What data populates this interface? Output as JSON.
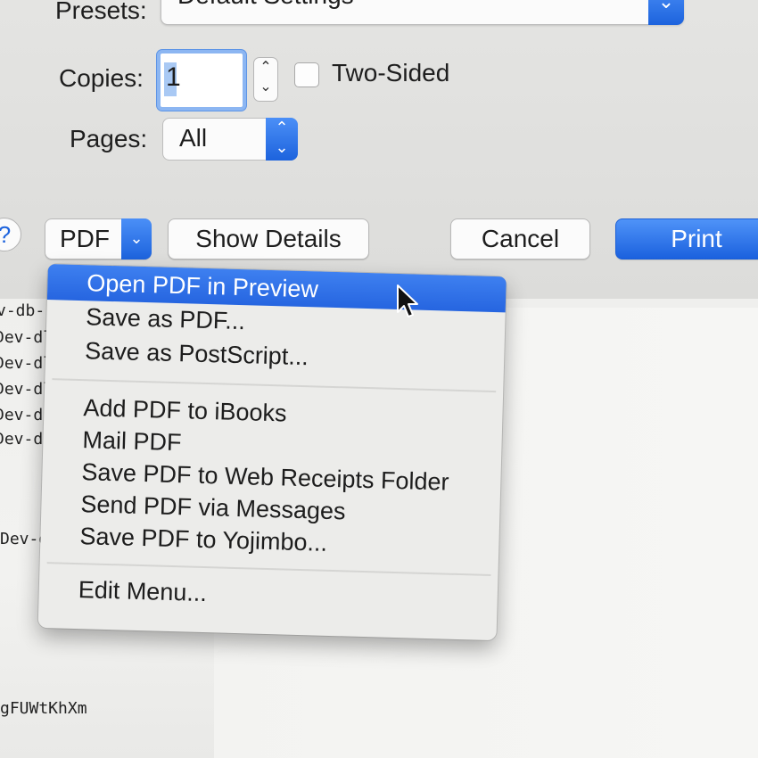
{
  "print_dialog": {
    "presets_label": "Presets:",
    "presets_value": "Default Settings",
    "copies_label": "Copies:",
    "copies_value": "1",
    "two_sided_label": "Two-Sided",
    "pages_label": "Pages:",
    "pages_value": "All",
    "help_label": "?",
    "pdf_button_label": "PDF",
    "show_details_label": "Show Details",
    "cancel_label": "Cancel",
    "print_label": "Print"
  },
  "pdf_menu": {
    "items": [
      {
        "label": "Open PDF in Preview"
      },
      {
        "label": "Save as PDF..."
      },
      {
        "label": "Save as PostScript..."
      },
      {
        "label": "Add PDF to iBooks"
      },
      {
        "label": "Mail PDF"
      },
      {
        "label": "Save PDF to Web Receipts Folder"
      },
      {
        "label": "Send PDF via Messages"
      },
      {
        "label": "Save PDF to Yojimbo..."
      },
      {
        "label": "Edit Menu..."
      }
    ],
    "highlighted": "Open PDF in Preview"
  },
  "document_background": {
    "lines": [
      "v-db-",
      "Dev-dl",
      "Dev-dl",
      "Dev-dl",
      "Dev-dl",
      "Dev-dl",
      "Dev-dl",
      "gFUWtKhXm"
    ]
  },
  "colors": {
    "accent": "#1d63dd",
    "menu_highlight": "#2f6fe6"
  },
  "icons": {
    "dropdown_arrow": "chevron-down-icon",
    "stepper": "up-down-stepper-icon",
    "cursor": "arrow-cursor-icon"
  }
}
